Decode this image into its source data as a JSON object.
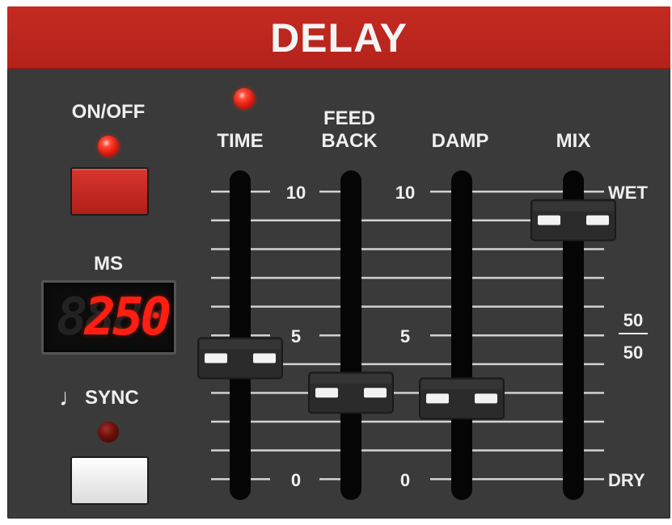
{
  "header": {
    "title": "DELAY"
  },
  "power": {
    "label": "ON/OFF",
    "led_on": true
  },
  "ms": {
    "label": "MS",
    "value": "250",
    "ghost": "8888"
  },
  "sync": {
    "note_glyph": "♩",
    "label": "SYNC",
    "led_on": false
  },
  "time_led_on": true,
  "sliders": [
    {
      "id": "time",
      "label_lines": [
        "TIME"
      ],
      "value": 4.2
    },
    {
      "id": "feedback",
      "label_lines": [
        "FEED",
        "BACK"
      ],
      "value": 3.0
    },
    {
      "id": "damp",
      "label_lines": [
        "DAMP"
      ],
      "value": 2.8
    },
    {
      "id": "mix",
      "label_lines": [
        "MIX"
      ],
      "value": 9.0
    }
  ],
  "scale_left": {
    "top": "10",
    "mid": "5",
    "bottom": "0"
  },
  "scale_mid": {
    "top": "10",
    "mid": "5",
    "bottom": "0"
  },
  "scale_right": {
    "top": "WET",
    "mid_top": "50",
    "mid_bottom": "50",
    "bottom": "DRY"
  },
  "colors": {
    "panel": "#3a3a3a",
    "header": "#b8251d",
    "led_red": "#ff2a18",
    "display_red": "#ff1f12"
  }
}
